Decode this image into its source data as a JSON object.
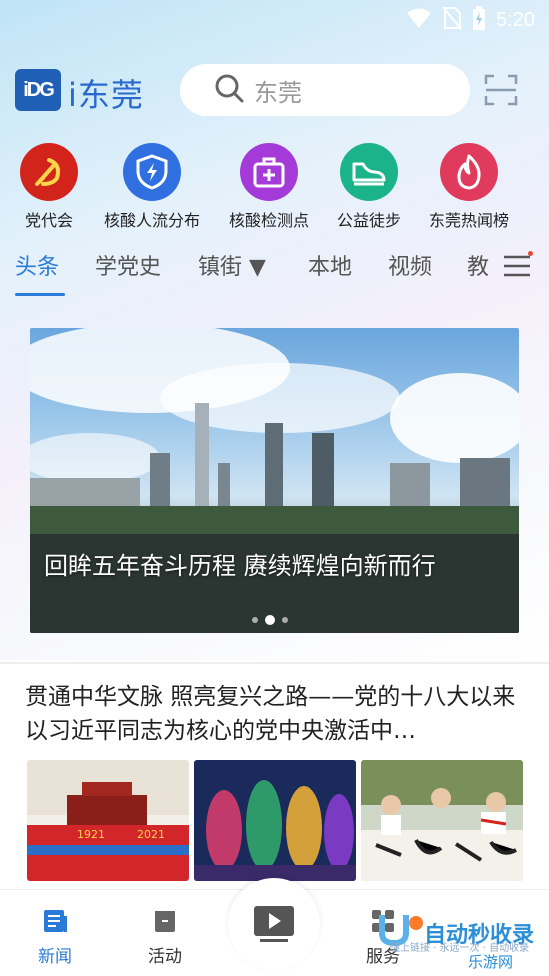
{
  "status_bar": {
    "time": "5:20"
  },
  "header": {
    "logo_mark": "iDG",
    "app_name": "i东莞",
    "search_placeholder": "东莞"
  },
  "quick_links": [
    {
      "label": "党代会",
      "icon": "party-emblem-icon",
      "color": "#d3241c"
    },
    {
      "label": "核酸人流分布",
      "icon": "shield-bolt-icon",
      "color": "#2f6fe0"
    },
    {
      "label": "核酸检测点",
      "icon": "medical-kit-icon",
      "color": "#a43bd8"
    },
    {
      "label": "公益徒步",
      "icon": "sneaker-icon",
      "color": "#1bb38a"
    },
    {
      "label": "东莞热闻榜",
      "icon": "flame-icon",
      "color": "#e03a5c"
    }
  ],
  "tabs": [
    {
      "label": "头条",
      "active": true
    },
    {
      "label": "学党史",
      "active": false
    },
    {
      "label": "镇街 ▼",
      "active": false
    },
    {
      "label": "本地",
      "active": false
    },
    {
      "label": "视频",
      "active": false
    },
    {
      "label": "教",
      "active": false
    }
  ],
  "banner": {
    "title": "回眸五年奋斗历程 赓续辉煌向新而行",
    "slide_count": 3,
    "active_slide": 2
  },
  "news": {
    "title": "贯通中华文脉 照亮复兴之路——党的十八大以来以习近平同志为核心的党中央激活中…",
    "thumb_labels": [
      "1921",
      "2021"
    ]
  },
  "bottom_nav": [
    {
      "label": "新闻",
      "icon": "newspaper-icon",
      "active": true
    },
    {
      "label": "活动",
      "icon": "calendar-icon",
      "active": false
    },
    {
      "label": "",
      "icon": "play-icon",
      "active": false
    },
    {
      "label": "服务",
      "icon": "grid-icon",
      "active": false
    }
  ],
  "watermark": {
    "text": "自动秒收录",
    "sub": "懂上链接 · 永远一次 · 自动收录",
    "site": "乐游网"
  },
  "colors": {
    "accent": "#2a7ad8",
    "brand": "#1f5fb6"
  }
}
